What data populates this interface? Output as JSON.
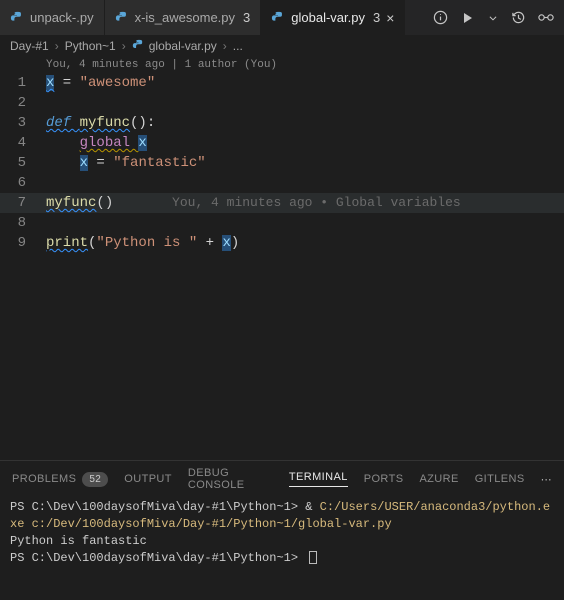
{
  "tabs": [
    {
      "label": "unpack-.py",
      "dirty": ""
    },
    {
      "label": "x-is_awesome.py",
      "dirty": "3"
    },
    {
      "label": "global-var.py",
      "dirty": "3"
    }
  ],
  "activeTabIndex": 2,
  "breadcrumb": {
    "seg1": "Day-#1",
    "seg2": "Python~1",
    "seg3": "global-var.py",
    "seg4": "..."
  },
  "codelens": "You, 4 minutes ago | 1 author (You)",
  "blame": "You, 4 minutes ago • Global variables",
  "code": {
    "l1": {
      "x": "x",
      "eq": " = ",
      "str": "\"awesome\""
    },
    "l3": {
      "def": "def ",
      "name": "myfunc",
      "par": "():"
    },
    "l4": {
      "indent": "    ",
      "kw": "global ",
      "x": "x"
    },
    "l5": {
      "indent": "    ",
      "x": "x",
      "eq": " = ",
      "str": "\"fantastic\""
    },
    "l7": {
      "call": "myfunc",
      "par": "()"
    },
    "l9": {
      "print": "print",
      "open": "(",
      "str": "\"Python is \"",
      "plus": " + ",
      "x": "x",
      "close": ")"
    }
  },
  "panel": {
    "tabs": {
      "problems": "PROBLEMS",
      "problemsCount": "52",
      "output": "OUTPUT",
      "debug": "DEBUG CONSOLE",
      "terminal": "TERMINAL",
      "ports": "PORTS",
      "azure": "AZURE",
      "gitlens": "GITLENS"
    },
    "terminal": {
      "prompt1": "PS C:\\Dev\\100daysofMiva\\day-#1\\Python~1> ",
      "amp": "& ",
      "cmd1": "C:/Users/USER/anaconda3/python.exe c:/Dev/100daysofMiva/Day-#1/Python~1/global-var.py",
      "out1": "Python is fantastic",
      "prompt2": "PS C:\\Dev\\100daysofMiva\\day-#1\\Python~1> "
    }
  },
  "lineNumbers": [
    "1",
    "2",
    "3",
    "4",
    "5",
    "6",
    "7",
    "8",
    "9"
  ]
}
